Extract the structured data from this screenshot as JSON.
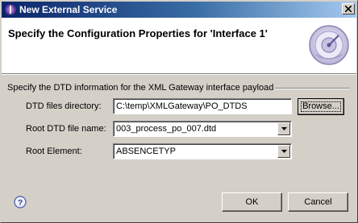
{
  "window": {
    "title": "New External Service",
    "close_icon": "close-x"
  },
  "banner": {
    "title": "Specify the Configuration Properties for 'Interface 1'",
    "graphic": "gauge-wizard-graphic"
  },
  "group": {
    "label": "Specify the DTD information for the XML Gateway interface payload"
  },
  "fields": {
    "dtd_dir": {
      "label": "DTD files directory:",
      "value": "C:\\temp\\XMLGateway\\PO_DTDS"
    },
    "root_dtd": {
      "label": "Root DTD file name:",
      "value": "003_process_po_007.dtd"
    },
    "root_element": {
      "label": "Root Element:",
      "value": "ABSENCETYP"
    }
  },
  "buttons": {
    "browse": "Browse...",
    "ok": "OK",
    "cancel": "Cancel"
  },
  "colors": {
    "titlebar_start": "#0a246a",
    "titlebar_end": "#a6caf0",
    "dialog_bg": "#d4d0c8"
  }
}
